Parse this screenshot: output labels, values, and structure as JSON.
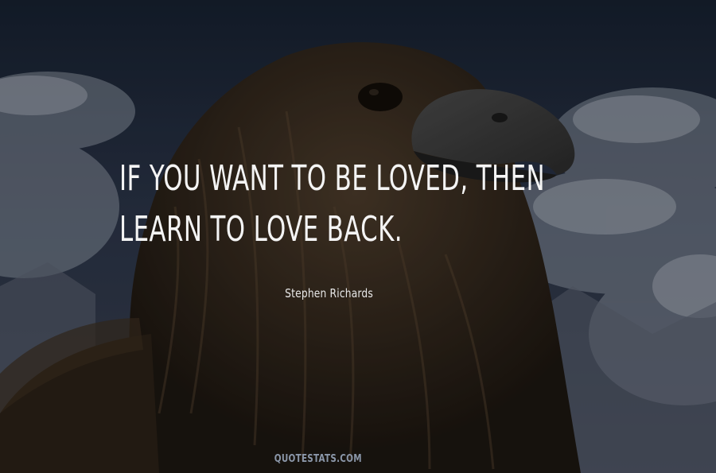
{
  "quote": {
    "lines": [
      "If you want to be loved, then",
      "learn to love back."
    ]
  },
  "author": "Stephen Richards",
  "watermark": "QUOTESTATS.COM"
}
